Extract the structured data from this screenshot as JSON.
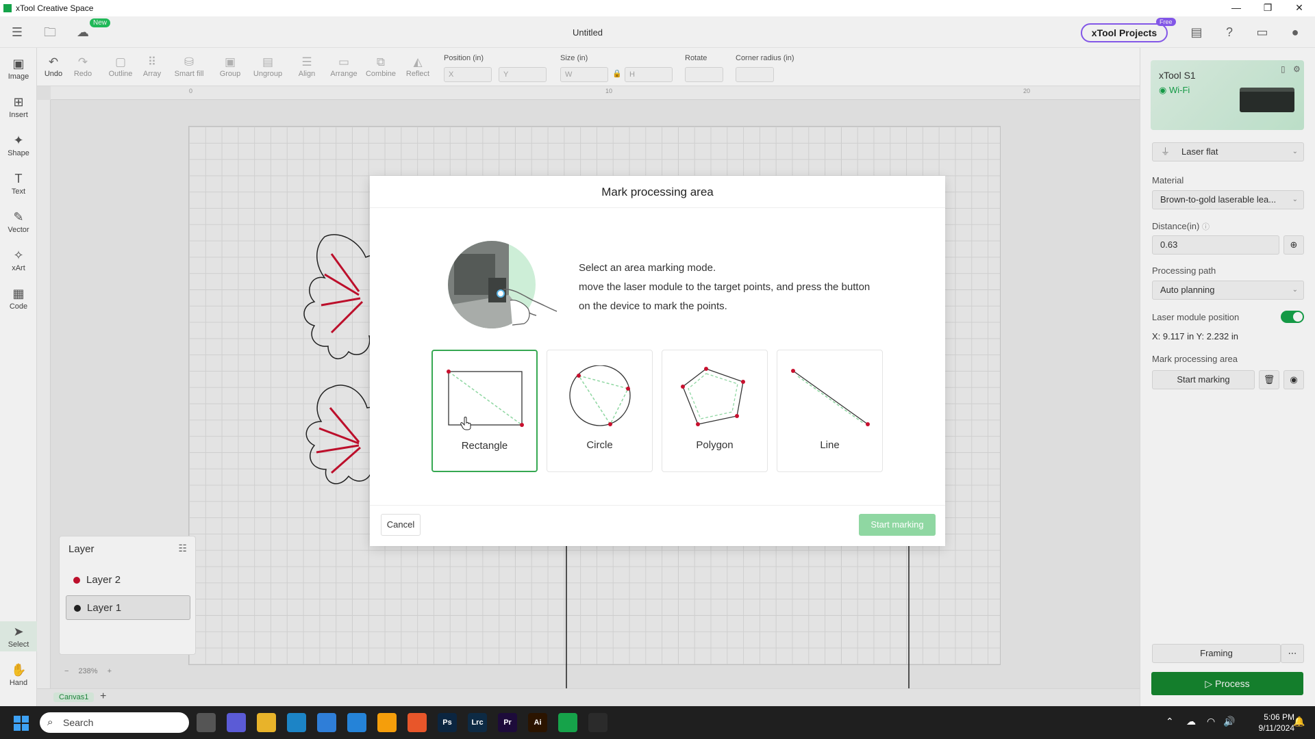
{
  "window": {
    "title": "xTool Creative Space",
    "controls": [
      "—",
      "❐",
      "✕"
    ]
  },
  "header": {
    "new_badge": "New",
    "doc_title": "Untitled",
    "projects_label": "xTool Projects",
    "free_badge": "Free"
  },
  "left_tools": [
    {
      "label": "Image",
      "icon": "image-icon",
      "glyph": "▣"
    },
    {
      "label": "Insert",
      "icon": "insert-icon",
      "glyph": "⊞"
    },
    {
      "label": "Shape",
      "icon": "shape-icon",
      "glyph": "✦"
    },
    {
      "label": "Text",
      "icon": "text-icon",
      "glyph": "T"
    },
    {
      "label": "Vector",
      "icon": "pen-icon",
      "glyph": "✎"
    },
    {
      "label": "xArt",
      "icon": "ai-icon",
      "glyph": "✧"
    },
    {
      "label": "Code",
      "icon": "barcode-icon",
      "glyph": "▦"
    },
    {
      "label": "Select",
      "icon": "cursor-icon",
      "glyph": "➤"
    },
    {
      "label": "Hand",
      "icon": "hand-icon",
      "glyph": "✋"
    }
  ],
  "toolbar": {
    "buttons": [
      {
        "label": "Undo",
        "glyph": "↶",
        "enabled": true
      },
      {
        "label": "Redo",
        "glyph": "↷",
        "enabled": false
      },
      {
        "label": "Outline",
        "glyph": "▢",
        "enabled": false
      },
      {
        "label": "Array",
        "glyph": "⠿",
        "enabled": false
      },
      {
        "label": "Smart fill",
        "glyph": "⛁",
        "enabled": false
      },
      {
        "label": "Group",
        "glyph": "▣",
        "enabled": false
      },
      {
        "label": "Ungroup",
        "glyph": "▤",
        "enabled": false
      },
      {
        "label": "Align",
        "glyph": "☰",
        "enabled": false
      },
      {
        "label": "Arrange",
        "glyph": "▭",
        "enabled": false
      },
      {
        "label": "Combine",
        "glyph": "⧉",
        "enabled": false
      },
      {
        "label": "Reflect",
        "glyph": "◭",
        "enabled": false
      }
    ],
    "position_label": "Position (in)",
    "x_placeholder": "X",
    "y_placeholder": "Y",
    "size_label": "Size (in)",
    "w_placeholder": "W",
    "h_placeholder": "H",
    "rotate_label": "Rotate",
    "corner_label": "Corner radius (in)"
  },
  "ruler": {
    "marks": [
      "0",
      "10",
      "20"
    ]
  },
  "canvas": {
    "zoom": "238%",
    "zoom_minus": "−",
    "zoom_plus": "+",
    "tab": "Canvas1",
    "add_tab": "+"
  },
  "layers": {
    "title": "Layer",
    "items": [
      {
        "name": "Layer 2",
        "color": "#c8102e",
        "selected": false
      },
      {
        "name": "Layer 1",
        "color": "#222222",
        "selected": true
      }
    ]
  },
  "right_panel": {
    "device_name": "xTool S1",
    "device_status": "Wi-Fi",
    "mode": "Laser flat",
    "material_label": "Material",
    "material_value": "Brown-to-gold laserable lea...",
    "distance_label": "Distance(in)",
    "distance_value": "0.63",
    "path_label": "Processing path",
    "path_value": "Auto planning",
    "module_label": "Laser module position",
    "module_toggle_on": true,
    "module_position": "X: 9.117 in   Y: 2.232 in",
    "mark_label": "Mark processing area",
    "mark_button": "Start marking",
    "framing": "Framing",
    "more": "⋯",
    "process": "Process",
    "accent": "#16862f"
  },
  "modal": {
    "title": "Mark processing area",
    "line1": "Select an area marking mode.",
    "line2": "move the laser module to the target points, and press the button on the device to mark the points.",
    "modes": [
      {
        "label": "Rectangle",
        "selected": true
      },
      {
        "label": "Circle",
        "selected": false
      },
      {
        "label": "Polygon",
        "selected": false
      },
      {
        "label": "Line",
        "selected": false
      }
    ],
    "cancel": "Cancel",
    "start": "Start marking"
  },
  "taskbar": {
    "search_placeholder": "Search",
    "apps": [
      {
        "name": "task-view-icon",
        "text": "",
        "bg": "#555555"
      },
      {
        "name": "copilot-icon",
        "text": "",
        "bg": "#5b5bd6"
      },
      {
        "name": "file-explorer-icon",
        "text": "",
        "bg": "#e8b32a"
      },
      {
        "name": "edge-icon",
        "text": "",
        "bg": "#1c84c6"
      },
      {
        "name": "store-icon",
        "text": "",
        "bg": "#2f7ed8"
      },
      {
        "name": "mixer-icon",
        "text": "",
        "bg": "#2583d8"
      },
      {
        "name": "network-app-icon",
        "text": "",
        "bg": "#f59e0b"
      },
      {
        "name": "firefox-icon",
        "text": "",
        "bg": "#e8562a"
      },
      {
        "name": "photoshop-icon",
        "text": "Ps",
        "bg": "#0b2540"
      },
      {
        "name": "lightroom-icon",
        "text": "Lrc",
        "bg": "#0d2a44"
      },
      {
        "name": "premiere-icon",
        "text": "Pr",
        "bg": "#1d0b3a"
      },
      {
        "name": "illustrator-icon",
        "text": "Ai",
        "bg": "#2b1400"
      },
      {
        "name": "xtool-taskbar-icon",
        "text": "",
        "bg": "#16a34a"
      },
      {
        "name": "chatgpt-icon",
        "text": "",
        "bg": "#2b2b2b"
      }
    ],
    "time": "5:06 PM",
    "date": "9/11/2024"
  }
}
